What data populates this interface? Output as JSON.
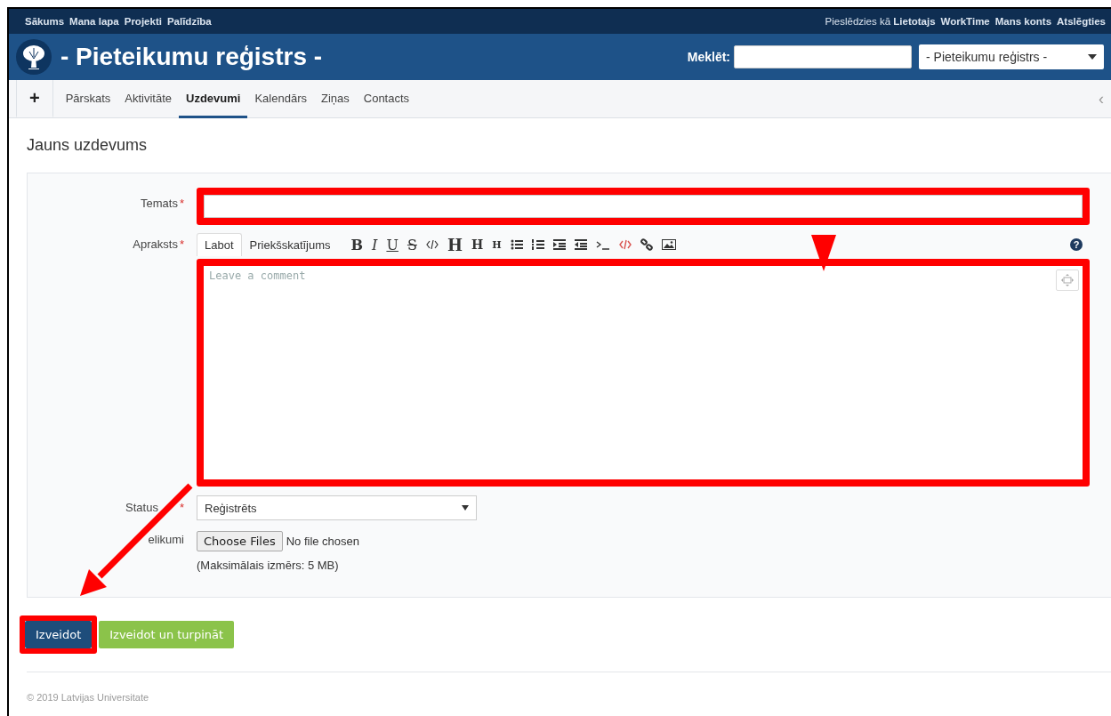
{
  "top_bar": {
    "left_links": [
      "Sākums",
      "Mana lapa",
      "Projekti",
      "Palīdzība"
    ],
    "logged_in": "Pieslēdzies kā **Lietotajs**",
    "right_links": [
      "WorkTime",
      "Mans konts",
      "Atslēgties"
    ]
  },
  "header": {
    "title": "- Pieteikumu reģistrs -",
    "search_label": "Meklēt:",
    "project_select": "- Pieteikumu reģistrs -"
  },
  "tabs": [
    {
      "label": "+",
      "kind": "add",
      "selected": false
    },
    {
      "label": "Pārskats",
      "kind": "tab",
      "selected": false
    },
    {
      "label": "Aktivitāte",
      "kind": "tab",
      "selected": false
    },
    {
      "label": "Uzdevumi",
      "kind": "tab",
      "selected": true
    },
    {
      "label": "Kalendārs",
      "kind": "tab",
      "selected": false
    },
    {
      "label": "Ziņas",
      "kind": "tab",
      "selected": false
    },
    {
      "label": "Contacts",
      "kind": "tab",
      "selected": false
    }
  ],
  "tab_scroll": "‹",
  "page_title": "Jauns uzdevums",
  "form": {
    "required_mark": "*",
    "help": "?",
    "subject_label": "Temats",
    "subject_required": true,
    "description_label": "Apraksts",
    "description_required": true,
    "editor_tabs": [
      {
        "label": "Labot",
        "selected": true
      },
      {
        "label": "Priekšskatījums",
        "selected": false
      }
    ],
    "toolbar": [
      {
        "kind": "bold",
        "label": "B"
      },
      {
        "kind": "italic",
        "label": "I"
      },
      {
        "kind": "underline",
        "label": "U"
      },
      {
        "kind": "strike",
        "label": "S"
      },
      {
        "kind": "code"
      },
      {
        "kind": "h1",
        "label": "H"
      },
      {
        "kind": "h2",
        "label": "H"
      },
      {
        "kind": "h3",
        "label": "H"
      },
      {
        "kind": "ul"
      },
      {
        "kind": "ol"
      },
      {
        "kind": "indent"
      },
      {
        "kind": "outdent"
      },
      {
        "kind": "terminal"
      },
      {
        "kind": "html"
      },
      {
        "kind": "link"
      },
      {
        "kind": "image"
      }
    ],
    "description_placeholder": "Leave a comment",
    "status_label": "Status",
    "status_required": true,
    "status_value": "Reģistrēts",
    "attachments_label": "elikumi",
    "choose_button": "Choose Files",
    "no_file": "No file chosen",
    "max_size": "(Maksimālais izmērs: 5 MB)"
  },
  "buttons": [
    {
      "label": "Izveidot",
      "kind": "primary"
    },
    {
      "label": "Izveidot un turpināt",
      "kind": "success"
    }
  ],
  "footer": "© 2019 Latvijas Universitate"
}
